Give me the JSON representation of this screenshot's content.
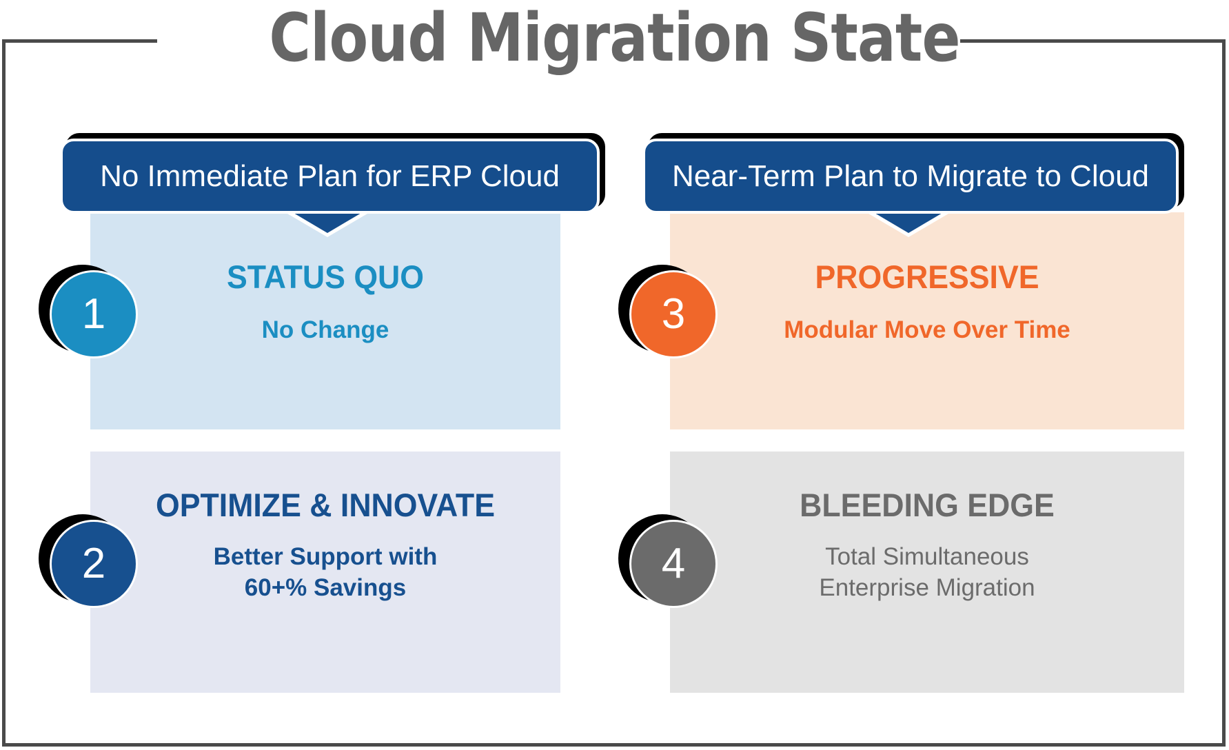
{
  "page": {
    "title": "Cloud Migration State",
    "frame_color": "#4a4a4a",
    "title_color": "#666666",
    "background": "#ffffff"
  },
  "columns": [
    {
      "banner_label": "No Immediate Plan for ERP Cloud",
      "banner_color": "#154d8c"
    },
    {
      "banner_label": "Near-Term Plan to Migrate to Cloud",
      "banner_color": "#154d8c"
    }
  ],
  "cards": [
    {
      "number": "1",
      "heading": "STATUS QUO",
      "subtext": "No Change",
      "subtext_line2": "",
      "bg_color": "#d3e4f2",
      "accent_color": "#1b8ec2",
      "badge_color": "#1b8ec2",
      "sub_weight": "bold"
    },
    {
      "number": "2",
      "heading": "OPTIMIZE & INNOVATE",
      "subtext": "Better Support with",
      "subtext_line2": "60+% Savings",
      "bg_color": "#e4e7f2",
      "accent_color": "#17508f",
      "badge_color": "#17508f",
      "sub_weight": "bold"
    },
    {
      "number": "3",
      "heading": "PROGRESSIVE",
      "subtext": "Modular Move Over Time",
      "subtext_line2": "",
      "bg_color": "#fae4d3",
      "accent_color": "#f0672a",
      "badge_color": "#f0672a",
      "sub_weight": "bold"
    },
    {
      "number": "4",
      "heading": "BLEEDING EDGE",
      "subtext": "Total Simultaneous",
      "subtext_line2": "Enterprise Migration",
      "bg_color": "#e3e3e3",
      "accent_color": "#6b6b6b",
      "badge_color": "#6b6b6b",
      "sub_weight": "regular"
    }
  ]
}
